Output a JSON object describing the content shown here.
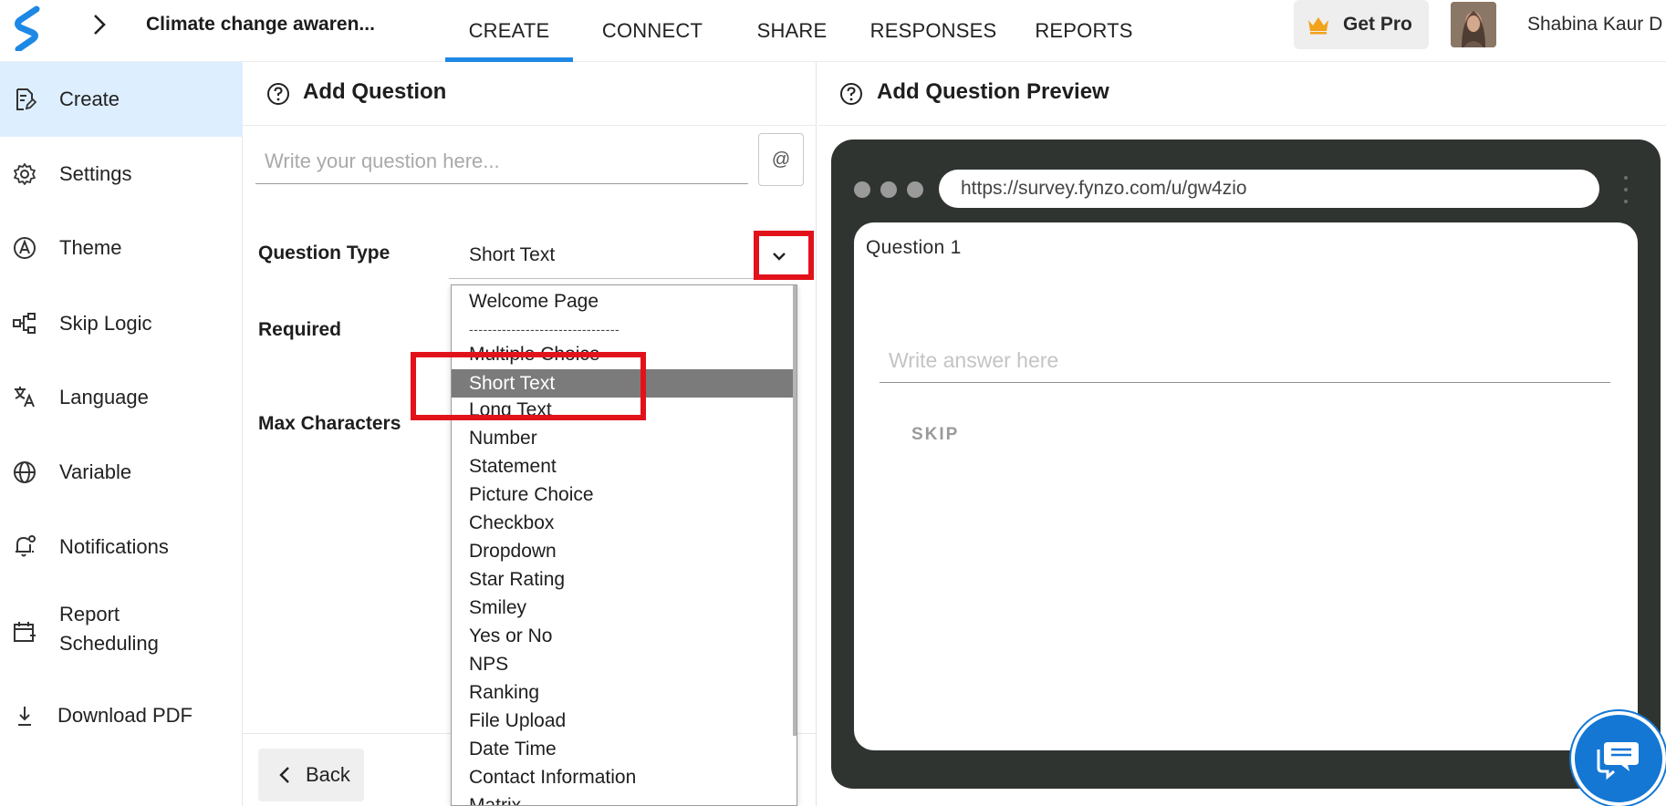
{
  "header": {
    "survey_title": "Climate change awaren...",
    "nav": [
      {
        "label": "CREATE",
        "active": true
      },
      {
        "label": "CONNECT",
        "active": false
      },
      {
        "label": "SHARE",
        "active": false
      },
      {
        "label": "RESPONSES",
        "active": false
      },
      {
        "label": "REPORTS",
        "active": false
      }
    ],
    "get_pro_label": "Get Pro",
    "user_name": "Shabina Kaur D"
  },
  "sidebar": {
    "items": [
      {
        "label": "Create",
        "icon": "form-edit-icon",
        "active": true
      },
      {
        "label": "Settings",
        "icon": "gear-icon",
        "active": false
      },
      {
        "label": "Theme",
        "icon": "palette-icon",
        "active": false
      },
      {
        "label": "Skip Logic",
        "icon": "flow-icon",
        "active": false
      },
      {
        "label": "Language",
        "icon": "translate-icon",
        "active": false
      },
      {
        "label": "Variable",
        "icon": "globe-icon",
        "active": false
      },
      {
        "label": "Notifications",
        "icon": "bell-icon",
        "active": false
      },
      {
        "label": "Report Scheduling",
        "icon": "calendar-icon",
        "active": false
      },
      {
        "label": "Download PDF",
        "icon": "download-icon",
        "active": false
      }
    ]
  },
  "editor": {
    "title": "Add Question",
    "question_placeholder": "Write your question here...",
    "at_label": "@",
    "question_type_label": "Question Type",
    "question_type_value": "Short Text",
    "required_label": "Required",
    "max_characters_label": "Max Characters",
    "back_label": "Back"
  },
  "dropdown": {
    "options": [
      "Welcome Page",
      "--------------------------------",
      "Multiple Choice",
      "Short Text",
      "Long Text",
      "Number",
      "Statement",
      "Picture Choice",
      "Checkbox",
      "Dropdown",
      "Star Rating",
      "Smiley",
      "Yes or No",
      "NPS",
      "Ranking",
      "File Upload",
      "Date Time",
      "Contact Information",
      "Matrix"
    ],
    "selected": "Short Text"
  },
  "preview": {
    "title": "Add Question Preview",
    "url": "https://survey.fynzo.com/u/gw4zio",
    "question_label": "Question 1",
    "answer_placeholder": "Write answer here",
    "skip_label": "SKIP"
  },
  "colors": {
    "accent": "#1e88e5",
    "highlight_box": "#e2121b",
    "preview_frame": "#2f3431",
    "chat": "#1477d4"
  }
}
